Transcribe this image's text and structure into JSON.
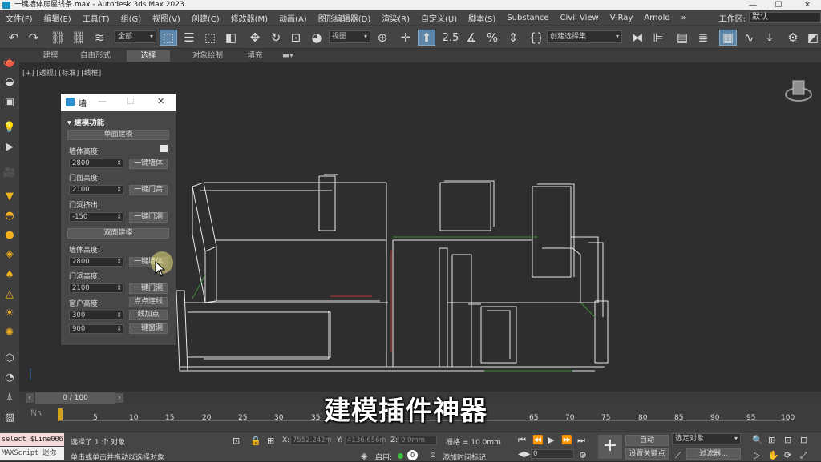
{
  "titlebar": {
    "title": "一键墙体房屋线条.max - Autodesk 3ds Max 2023",
    "minimize": "—",
    "maximize": "☐",
    "close": "✕"
  },
  "menubar": {
    "items": [
      "文件(F)",
      "编辑(E)",
      "工具(T)",
      "组(G)",
      "视图(V)",
      "创建(C)",
      "修改器(M)",
      "动画(A)",
      "图形编辑器(D)",
      "渲染(R)",
      "自定义(U)",
      "脚本(S)",
      "Substance",
      "Civil View",
      "V-Ray",
      "Arnold"
    ],
    "more": "»",
    "workspace_label": "工作区:",
    "workspace_value": "默认"
  },
  "toolbar": {
    "selection_filter": "全部",
    "ref_coord": "视图",
    "named_selection": "创建选择集",
    "snap_label": "2.5"
  },
  "ribbon": {
    "tabs": [
      "建模",
      "自由形式",
      "选择",
      "对象绘制",
      "填充"
    ],
    "selected": "选择"
  },
  "viewport": {
    "label": "[+] [透视] [标准] [线框]"
  },
  "dialog": {
    "title": "墙",
    "minimize": "—",
    "maximize": "☐",
    "close": "✕",
    "section": "建模功能",
    "single_btn": "单面建模",
    "wall_height_label": "墙体高度:",
    "wall_height_value": "2800",
    "wall_btn": "一键墙体",
    "door_height_label": "门面高度:",
    "door_height_value": "2100",
    "door_btn": "一键门高",
    "door_extrude_label": "门洞挤出:",
    "door_extrude_value": "-150",
    "door_hole_btn": "一键门洞",
    "double_btn": "双面建模",
    "wall_height2_label": "墙体高度:",
    "wall_height2_value": "2800",
    "wall_btn2": "一键墙体",
    "door_hole_height_label": "门洞高度:",
    "door_hole_height_value": "2100",
    "door_hole_btn2": "一键门洞",
    "window_height_label": "窗户高度:",
    "window_value1": "300",
    "window_value2": "900",
    "connect_btn": "点点连线",
    "add_point_btn": "线加点",
    "window_btn": "一键窗洞"
  },
  "timeline": {
    "frame": "0 / 100",
    "ticks": [
      "5",
      "10",
      "15",
      "20",
      "25",
      "30",
      "35",
      "65",
      "70",
      "75",
      "80",
      "85",
      "90",
      "95",
      "100"
    ]
  },
  "subtitle": "建模插件神器",
  "status": {
    "script_line1": "select $Line006",
    "script_line2": "MAXScript 迷你",
    "selected": "选择了 1 个 对象",
    "hint": "单击或单击并拖动以选择对象",
    "x_label": "X:",
    "x_value": "7552.242m",
    "y_label": "Y:",
    "y_value": "4136.656m",
    "z_label": "Z:",
    "z_value": "0.0mm",
    "grid": "栅格 = 10.0mm",
    "enabled": "启用:",
    "add_time_tag": "添加时间标记",
    "auto": "自动",
    "selected_object": "选定对象",
    "set_key": "设置关键点",
    "filters": "过滤器...",
    "frame_value": "0"
  }
}
